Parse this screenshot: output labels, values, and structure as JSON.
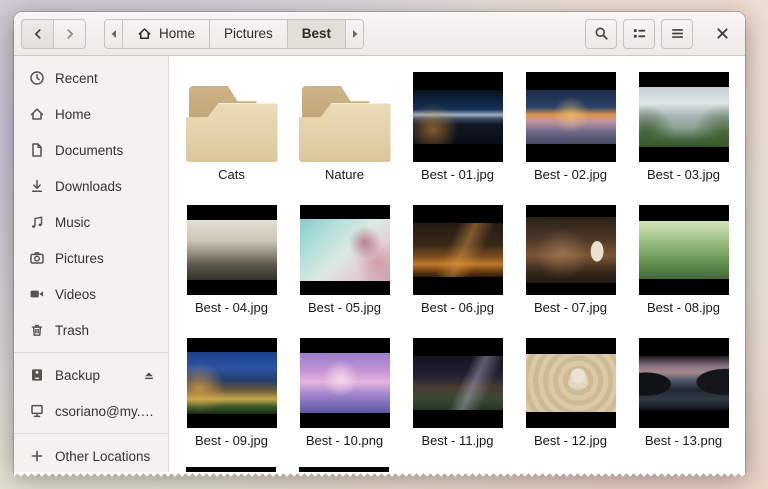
{
  "headerbar": {
    "nav": {
      "back_icon": "chevron-left",
      "forward_icon": "chevron-right"
    },
    "pathbar": {
      "scroll_left_icon": "triangle-left",
      "scroll_right_icon": "triangle-right",
      "crumbs": [
        {
          "label": "Home",
          "icon": "home",
          "active": false
        },
        {
          "label": "Pictures",
          "icon": null,
          "active": false
        },
        {
          "label": "Best",
          "icon": null,
          "active": true
        }
      ]
    },
    "actions": [
      {
        "name": "search",
        "icon": "magnifier"
      },
      {
        "name": "view-list",
        "icon": "list-view"
      },
      {
        "name": "menu",
        "icon": "hamburger"
      }
    ],
    "close_icon": "close-x"
  },
  "sidebar": {
    "places": [
      {
        "label": "Recent",
        "icon": "clock"
      },
      {
        "label": "Home",
        "icon": "home"
      },
      {
        "label": "Documents",
        "icon": "document"
      },
      {
        "label": "Downloads",
        "icon": "download-arrow"
      },
      {
        "label": "Music",
        "icon": "music-notes"
      },
      {
        "label": "Pictures",
        "icon": "camera"
      },
      {
        "label": "Videos",
        "icon": "video-camera"
      },
      {
        "label": "Trash",
        "icon": "trash-bin"
      }
    ],
    "devices": [
      {
        "label": "Backup",
        "icon": "hard-drive",
        "eject": true
      },
      {
        "label": "csoriano@my.…",
        "icon": "remote-computer",
        "eject": false
      }
    ],
    "footer": {
      "label": "Other Locations",
      "icon": "plus"
    }
  },
  "files": {
    "items": [
      {
        "name": "Cats",
        "kind": "folder"
      },
      {
        "name": "Nature",
        "kind": "folder"
      },
      {
        "name": "Best - 01.jpg",
        "kind": "image",
        "subject": "city skyline at night"
      },
      {
        "name": "Best - 02.jpg",
        "kind": "image",
        "subject": "sunset over coastal bay"
      },
      {
        "name": "Best - 03.jpg",
        "kind": "image",
        "subject": "daytime skyline with green hills"
      },
      {
        "name": "Best - 04.jpg",
        "kind": "image",
        "subject": "sepia cityscape with bridge"
      },
      {
        "name": "Best - 05.jpg",
        "kind": "image",
        "subject": "cherry blossom branch"
      },
      {
        "name": "Best - 06.jpg",
        "kind": "image",
        "subject": "illuminated bridge at night"
      },
      {
        "name": "Best - 07.jpg",
        "kind": "image",
        "subject": "lantern-lit alley at night"
      },
      {
        "name": "Best - 08.jpg",
        "kind": "image",
        "subject": "green aerial town view"
      },
      {
        "name": "Best - 09.jpg",
        "kind": "image",
        "subject": "night street with light trails"
      },
      {
        "name": "Best - 10.png",
        "kind": "image",
        "subject": "purple snowy landscape"
      },
      {
        "name": "Best - 11.jpg",
        "kind": "image",
        "subject": "mountains under starry sky"
      },
      {
        "name": "Best - 12.jpg",
        "kind": "image",
        "subject": "zen stones on raked sand"
      },
      {
        "name": "Best - 13.png",
        "kind": "image",
        "subject": "dark lake with reflections"
      }
    ],
    "partially_visible_items": 2
  },
  "colors": {
    "folder_body": "#e2d2ab",
    "folder_flap": "#c7ad80",
    "thumbnail_letterbox": "#000000",
    "headerbar_bg": "#f1efec",
    "sidebar_bg": "#f3f2f0",
    "content_bg": "#ffffff"
  }
}
